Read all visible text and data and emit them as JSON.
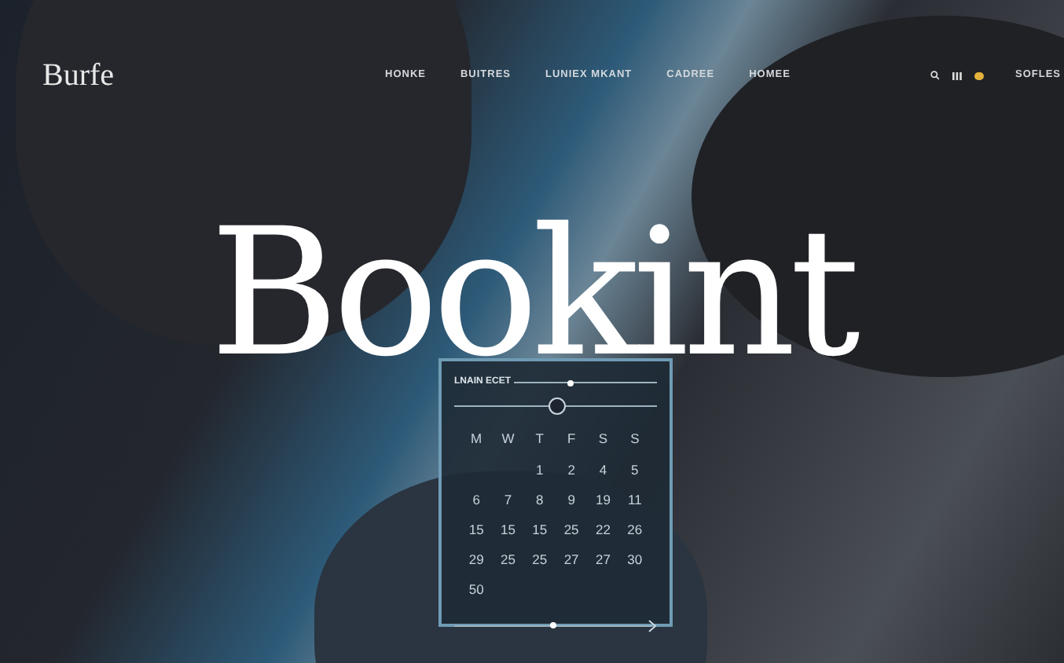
{
  "logo": "Burfe",
  "nav": [
    {
      "label": "HONKE"
    },
    {
      "label": "BUITRES"
    },
    {
      "label": "LUNIEX MKANT"
    },
    {
      "label": "CADREE"
    },
    {
      "label": "HOMEE"
    }
  ],
  "account": "SOFLES",
  "hero": "Bookint",
  "calendar": {
    "label": "LNAIN ECET",
    "top_slider": {
      "level": 0.4
    },
    "mid_slider": {
      "level": 0.5
    },
    "weekdays": [
      "M",
      "W",
      "T",
      "F",
      "S",
      "S"
    ],
    "weeks": [
      [
        "1",
        "2",
        "4",
        "5"
      ],
      [
        "6",
        "7",
        "8",
        "9",
        "19",
        "11"
      ],
      [
        "15",
        "15",
        "15",
        "25",
        "22",
        "26"
      ],
      [
        "29",
        "25",
        "25",
        "27",
        "27",
        "30"
      ],
      [
        "50"
      ]
    ],
    "bottom_slider": {
      "level": 0.5
    }
  }
}
